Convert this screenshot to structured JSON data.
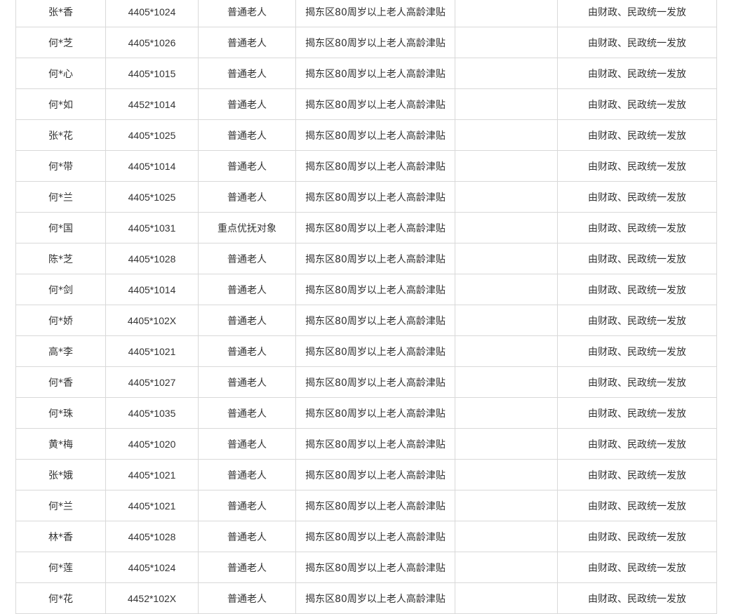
{
  "table": {
    "rows": [
      {
        "name": "张*香",
        "id": "4405*1024",
        "category": "普通老人",
        "subsidy": "揭东区80周岁以上老人高龄津贴",
        "note": "",
        "payment": "由财政、民政统一发放"
      },
      {
        "name": "何*芝",
        "id": "4405*1026",
        "category": "普通老人",
        "subsidy": "揭东区80周岁以上老人高龄津贴",
        "note": "",
        "payment": "由财政、民政统一发放"
      },
      {
        "name": "何*心",
        "id": "4405*1015",
        "category": "普通老人",
        "subsidy": "揭东区80周岁以上老人高龄津贴",
        "note": "",
        "payment": "由财政、民政统一发放"
      },
      {
        "name": "何*如",
        "id": "4452*1014",
        "category": "普通老人",
        "subsidy": "揭东区80周岁以上老人高龄津贴",
        "note": "",
        "payment": "由财政、民政统一发放"
      },
      {
        "name": "张*花",
        "id": "4405*1025",
        "category": "普通老人",
        "subsidy": "揭东区80周岁以上老人高龄津贴",
        "note": "",
        "payment": "由财政、民政统一发放"
      },
      {
        "name": "何*带",
        "id": "4405*1014",
        "category": "普通老人",
        "subsidy": "揭东区80周岁以上老人高龄津贴",
        "note": "",
        "payment": "由财政、民政统一发放"
      },
      {
        "name": "何*兰",
        "id": "4405*1025",
        "category": "普通老人",
        "subsidy": "揭东区80周岁以上老人高龄津贴",
        "note": "",
        "payment": "由财政、民政统一发放"
      },
      {
        "name": "何*国",
        "id": "4405*1031",
        "category": "重点优抚对象",
        "subsidy": "揭东区80周岁以上老人高龄津贴",
        "note": "",
        "payment": "由财政、民政统一发放"
      },
      {
        "name": "陈*芝",
        "id": "4405*1028",
        "category": "普通老人",
        "subsidy": "揭东区80周岁以上老人高龄津贴",
        "note": "",
        "payment": "由财政、民政统一发放"
      },
      {
        "name": "何*剑",
        "id": "4405*1014",
        "category": "普通老人",
        "subsidy": "揭东区80周岁以上老人高龄津贴",
        "note": "",
        "payment": "由财政、民政统一发放"
      },
      {
        "name": "何*娇",
        "id": "4405*102X",
        "category": "普通老人",
        "subsidy": "揭东区80周岁以上老人高龄津贴",
        "note": "",
        "payment": "由财政、民政统一发放"
      },
      {
        "name": "高*李",
        "id": "4405*1021",
        "category": "普通老人",
        "subsidy": "揭东区80周岁以上老人高龄津贴",
        "note": "",
        "payment": "由财政、民政统一发放"
      },
      {
        "name": "何*香",
        "id": "4405*1027",
        "category": "普通老人",
        "subsidy": "揭东区80周岁以上老人高龄津贴",
        "note": "",
        "payment": "由财政、民政统一发放"
      },
      {
        "name": "何*珠",
        "id": "4405*1035",
        "category": "普通老人",
        "subsidy": "揭东区80周岁以上老人高龄津贴",
        "note": "",
        "payment": "由财政、民政统一发放"
      },
      {
        "name": "黄*梅",
        "id": "4405*1020",
        "category": "普通老人",
        "subsidy": "揭东区80周岁以上老人高龄津贴",
        "note": "",
        "payment": "由财政、民政统一发放"
      },
      {
        "name": "张*娥",
        "id": "4405*1021",
        "category": "普通老人",
        "subsidy": "揭东区80周岁以上老人高龄津贴",
        "note": "",
        "payment": "由财政、民政统一发放"
      },
      {
        "name": "何*兰",
        "id": "4405*1021",
        "category": "普通老人",
        "subsidy": "揭东区80周岁以上老人高龄津贴",
        "note": "",
        "payment": "由财政、民政统一发放"
      },
      {
        "name": "林*香",
        "id": "4405*1028",
        "category": "普通老人",
        "subsidy": "揭东区80周岁以上老人高龄津贴",
        "note": "",
        "payment": "由财政、民政统一发放"
      },
      {
        "name": "何*莲",
        "id": "4405*1024",
        "category": "普通老人",
        "subsidy": "揭东区80周岁以上老人高龄津贴",
        "note": "",
        "payment": "由财政、民政统一发放"
      },
      {
        "name": "何*花",
        "id": "4452*102X",
        "category": "普通老人",
        "subsidy": "揭东区80周岁以上老人高龄津贴",
        "note": "",
        "payment": "由财政、民政统一发放"
      }
    ]
  }
}
